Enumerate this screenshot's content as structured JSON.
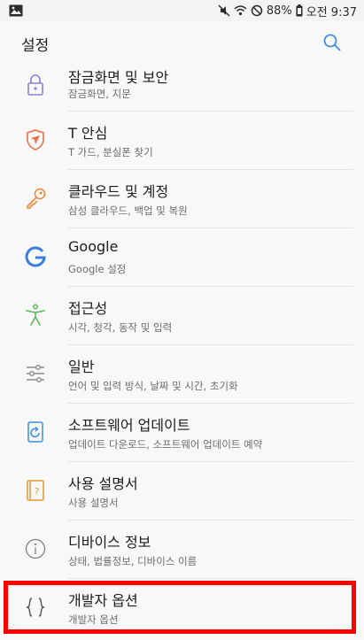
{
  "status_bar": {
    "battery": "88%",
    "time": "오전 9:37",
    "icons": [
      "image-icon",
      "mute-icon",
      "wifi-icon",
      "do-not-disturb-icon",
      "battery-icon"
    ]
  },
  "app_bar": {
    "title": "설정",
    "search_icon": "search-icon"
  },
  "items": [
    {
      "title": "잠금화면 및 보안",
      "subtitle": "잠금화면, 지문",
      "icon": "lock-icon",
      "color": "#8c7fd6"
    },
    {
      "title": "T 안심",
      "subtitle": "T 가드, 분실폰 찾기",
      "icon": "shield-icon",
      "color": "#ee6f45"
    },
    {
      "title": "클라우드 및 계정",
      "subtitle": "삼성 클라우드, 백업 및 복원",
      "icon": "key-icon",
      "color": "#f08a3c"
    },
    {
      "title": "Google",
      "subtitle": "Google 설정",
      "icon": "google-icon",
      "color": "#3b7ddd"
    },
    {
      "title": "접근성",
      "subtitle": "시각, 청각, 동작 및 입력",
      "icon": "accessibility-icon",
      "color": "#5cb85c"
    },
    {
      "title": "일반",
      "subtitle": "언어 및 입력 방식, 날짜 및 시간, 초기화",
      "icon": "sliders-icon",
      "color": "#8a8a8a"
    },
    {
      "title": "소프트웨어 업데이트",
      "subtitle": "업데이트 다운로드, 소프트웨어 업데이트 예약",
      "icon": "software-update-icon",
      "color": "#3b8de0"
    },
    {
      "title": "사용 설명서",
      "subtitle": "사용 설명서",
      "icon": "user-manual-icon",
      "color": "#e09b2f"
    },
    {
      "title": "디바이스 정보",
      "subtitle": "상태, 법률정보, 디바이스 이름",
      "icon": "info-icon",
      "color": "#8a8a8a"
    },
    {
      "title": "개발자 옵션",
      "subtitle": "개발자 옵션",
      "icon": "developer-options-icon",
      "color": "#555555"
    }
  ],
  "highlight_color": "#ff0000"
}
